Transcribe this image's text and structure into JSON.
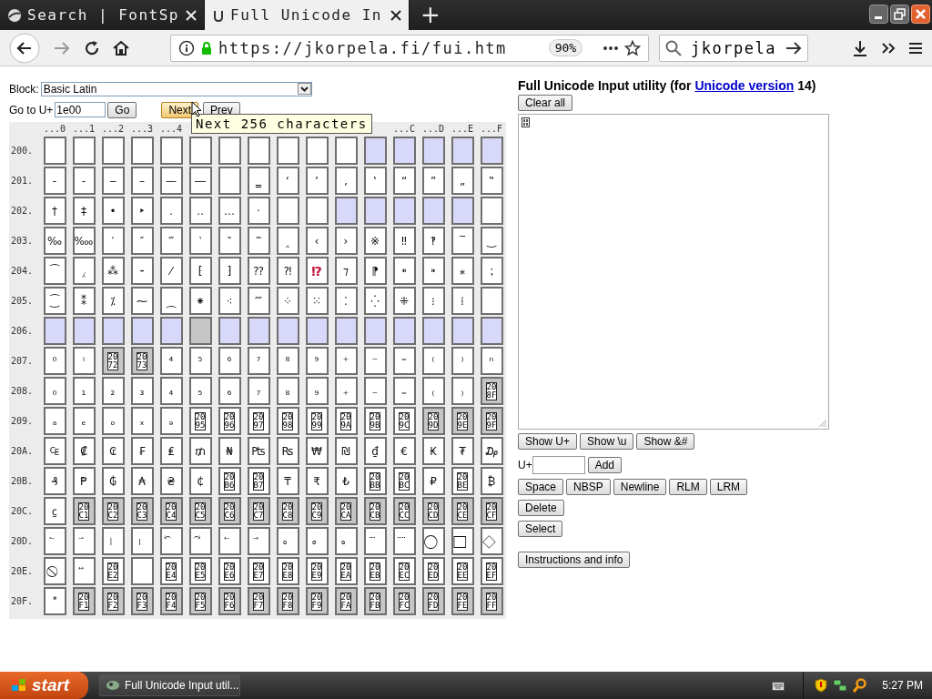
{
  "browser": {
    "tabs": [
      {
        "title": "Search | FontSp",
        "selected": false
      },
      {
        "title": "Full Unicode In",
        "selected": true
      }
    ],
    "new_tab": "+",
    "url": "https://jkorpela.fi/fui.htm",
    "zoom": "90%",
    "search": "jkorpela"
  },
  "left": {
    "block_label": "Block:",
    "block_value": "Basic Latin",
    "goto_label": "Go to U+",
    "goto_value": "1e00",
    "buttons": [
      "Go",
      "Next",
      "Prev"
    ]
  },
  "tooltip": "Next 256 characters",
  "grid": {
    "headers_left": [
      "...0",
      "...1",
      "...2",
      "...3",
      "...4"
    ],
    "headers_right": [
      "...C",
      "...D",
      "...E",
      "...F"
    ],
    "rows": [
      {
        "label": "200.",
        "cells": [
          {
            "kind": "blank"
          },
          {
            "kind": "blank"
          },
          {
            "kind": "blank"
          },
          {
            "kind": "blank"
          },
          {
            "kind": "blank"
          },
          {
            "kind": "blank"
          },
          {
            "kind": "blank"
          },
          {
            "kind": "blank"
          },
          {
            "kind": "blank"
          },
          {
            "kind": "blank"
          },
          {
            "kind": "blank"
          },
          {
            "kind": "format"
          },
          {
            "kind": "format"
          },
          {
            "kind": "format"
          },
          {
            "kind": "format"
          },
          {
            "kind": "format"
          }
        ]
      },
      {
        "label": "201.",
        "cells": [
          {
            "kind": "char",
            "text": "‐"
          },
          {
            "kind": "char",
            "text": "‑"
          },
          {
            "kind": "char",
            "text": "‒"
          },
          {
            "kind": "char",
            "text": "–"
          },
          {
            "kind": "char",
            "text": "—"
          },
          {
            "kind": "char",
            "text": "―"
          },
          {
            "kind": "blank"
          },
          {
            "kind": "char",
            "text": "‗"
          },
          {
            "kind": "char",
            "text": "‘"
          },
          {
            "kind": "char",
            "text": "’"
          },
          {
            "kind": "char",
            "text": "‚"
          },
          {
            "kind": "char",
            "text": "‛"
          },
          {
            "kind": "char",
            "text": "“"
          },
          {
            "kind": "char",
            "text": "”"
          },
          {
            "kind": "char",
            "text": "„"
          },
          {
            "kind": "char",
            "text": "‟"
          }
        ]
      },
      {
        "label": "202.",
        "cells": [
          {
            "kind": "char",
            "text": "†"
          },
          {
            "kind": "char",
            "text": "‡"
          },
          {
            "kind": "char",
            "text": "•"
          },
          {
            "kind": "char",
            "text": "‣"
          },
          {
            "kind": "char",
            "text": "․"
          },
          {
            "kind": "char",
            "text": "‥"
          },
          {
            "kind": "char",
            "text": "…"
          },
          {
            "kind": "char",
            "text": "‧"
          },
          {
            "kind": "blank"
          },
          {
            "kind": "blank"
          },
          {
            "kind": "format"
          },
          {
            "kind": "format"
          },
          {
            "kind": "format"
          },
          {
            "kind": "format"
          },
          {
            "kind": "format"
          },
          {
            "kind": "blank"
          }
        ]
      },
      {
        "label": "203.",
        "cells": [
          {
            "kind": "char",
            "text": "‰"
          },
          {
            "kind": "char",
            "text": "‱"
          },
          {
            "kind": "char",
            "text": "′"
          },
          {
            "kind": "char",
            "text": "″"
          },
          {
            "kind": "char",
            "text": "‴"
          },
          {
            "kind": "char",
            "text": "‵"
          },
          {
            "kind": "char",
            "text": "‶"
          },
          {
            "kind": "char",
            "text": "‷"
          },
          {
            "kind": "char",
            "text": "‸"
          },
          {
            "kind": "char",
            "text": "‹"
          },
          {
            "kind": "char",
            "text": "›"
          },
          {
            "kind": "char",
            "text": "※"
          },
          {
            "kind": "char",
            "text": "‼"
          },
          {
            "kind": "char",
            "text": "‽"
          },
          {
            "kind": "char",
            "text": "‾"
          },
          {
            "kind": "char",
            "text": "‿"
          }
        ]
      },
      {
        "label": "204.",
        "cells": [
          {
            "kind": "char",
            "text": "⁀"
          },
          {
            "kind": "char",
            "text": "⁁"
          },
          {
            "kind": "char",
            "text": "⁂"
          },
          {
            "kind": "char",
            "text": "⁃"
          },
          {
            "kind": "char",
            "text": "⁄"
          },
          {
            "kind": "char",
            "text": "⁅"
          },
          {
            "kind": "char",
            "text": "⁆"
          },
          {
            "kind": "char",
            "text": "⁇"
          },
          {
            "kind": "char",
            "text": "⁈"
          },
          {
            "kind": "char",
            "text": "⁉",
            "color": "#c0143c"
          },
          {
            "kind": "char",
            "text": "⁊"
          },
          {
            "kind": "char",
            "text": "⁋"
          },
          {
            "kind": "char",
            "text": "⁌"
          },
          {
            "kind": "char",
            "text": "⁍"
          },
          {
            "kind": "char",
            "text": "⁎"
          },
          {
            "kind": "char",
            "text": "⁏"
          }
        ]
      },
      {
        "label": "205.",
        "cells": [
          {
            "kind": "char",
            "text": "⁐"
          },
          {
            "kind": "char",
            "text": "⁑"
          },
          {
            "kind": "char",
            "text": "⁒"
          },
          {
            "kind": "char",
            "text": "⁓"
          },
          {
            "kind": "char",
            "text": "⁔"
          },
          {
            "kind": "char",
            "text": "⁕"
          },
          {
            "kind": "char",
            "text": "⁖"
          },
          {
            "kind": "char",
            "text": "⁗"
          },
          {
            "kind": "char",
            "text": "⁘"
          },
          {
            "kind": "char",
            "text": "⁙"
          },
          {
            "kind": "char",
            "text": "⁚"
          },
          {
            "kind": "char",
            "text": "⁛"
          },
          {
            "kind": "char",
            "text": "⁜"
          },
          {
            "kind": "char",
            "text": "⁝"
          },
          {
            "kind": "char",
            "text": "⁞"
          },
          {
            "kind": "blank"
          }
        ]
      },
      {
        "label": "206.",
        "cells": [
          {
            "kind": "format"
          },
          {
            "kind": "format"
          },
          {
            "kind": "format"
          },
          {
            "kind": "format"
          },
          {
            "kind": "format"
          },
          {
            "kind": "reserved"
          },
          {
            "kind": "format"
          },
          {
            "kind": "format"
          },
          {
            "kind": "format"
          },
          {
            "kind": "format"
          },
          {
            "kind": "format"
          },
          {
            "kind": "format"
          },
          {
            "kind": "format"
          },
          {
            "kind": "format"
          },
          {
            "kind": "format"
          },
          {
            "kind": "format"
          }
        ]
      },
      {
        "label": "207.",
        "cells": [
          {
            "kind": "char",
            "text": "⁰"
          },
          {
            "kind": "char",
            "text": "ⁱ"
          },
          {
            "kind": "tofu_reserved",
            "text": "2072"
          },
          {
            "kind": "tofu_reserved",
            "text": "2073"
          },
          {
            "kind": "char",
            "text": "⁴"
          },
          {
            "kind": "char",
            "text": "⁵"
          },
          {
            "kind": "char",
            "text": "⁶"
          },
          {
            "kind": "char",
            "text": "⁷"
          },
          {
            "kind": "char",
            "text": "⁸"
          },
          {
            "kind": "char",
            "text": "⁹"
          },
          {
            "kind": "char",
            "text": "⁺"
          },
          {
            "kind": "char",
            "text": "⁻"
          },
          {
            "kind": "char",
            "text": "⁼"
          },
          {
            "kind": "char",
            "text": "⁽"
          },
          {
            "kind": "char",
            "text": "⁾"
          },
          {
            "kind": "char",
            "text": "ⁿ"
          }
        ]
      },
      {
        "label": "208.",
        "cells": [
          {
            "kind": "char",
            "text": "₀"
          },
          {
            "kind": "char",
            "text": "₁"
          },
          {
            "kind": "char",
            "text": "₂"
          },
          {
            "kind": "char",
            "text": "₃"
          },
          {
            "kind": "char",
            "text": "₄"
          },
          {
            "kind": "char",
            "text": "₅"
          },
          {
            "kind": "char",
            "text": "₆"
          },
          {
            "kind": "char",
            "text": "₇"
          },
          {
            "kind": "char",
            "text": "₈"
          },
          {
            "kind": "char",
            "text": "₉"
          },
          {
            "kind": "char",
            "text": "₊"
          },
          {
            "kind": "char",
            "text": "₋"
          },
          {
            "kind": "char",
            "text": "₌"
          },
          {
            "kind": "char",
            "text": "₍"
          },
          {
            "kind": "char",
            "text": "₎"
          },
          {
            "kind": "tofu_reserved",
            "text": "208F"
          }
        ]
      },
      {
        "label": "209.",
        "cells": [
          {
            "kind": "char",
            "text": "ₐ"
          },
          {
            "kind": "char",
            "text": "ₑ"
          },
          {
            "kind": "char",
            "text": "ₒ"
          },
          {
            "kind": "char",
            "text": "ₓ"
          },
          {
            "kind": "char",
            "text": "ₔ"
          },
          {
            "kind": "tofu",
            "text": "2095"
          },
          {
            "kind": "tofu",
            "text": "2096"
          },
          {
            "kind": "tofu",
            "text": "2097"
          },
          {
            "kind": "tofu",
            "text": "2098"
          },
          {
            "kind": "tofu",
            "text": "2099"
          },
          {
            "kind": "tofu",
            "text": "209A"
          },
          {
            "kind": "tofu",
            "text": "209B"
          },
          {
            "kind": "tofu",
            "text": "209C"
          },
          {
            "kind": "tofu_reserved",
            "text": "209D"
          },
          {
            "kind": "tofu_reserved",
            "text": "209E"
          },
          {
            "kind": "tofu_reserved",
            "text": "209F"
          }
        ]
      },
      {
        "label": "20A.",
        "cells": [
          {
            "kind": "char",
            "text": "₠"
          },
          {
            "kind": "char",
            "text": "₡"
          },
          {
            "kind": "char",
            "text": "₢"
          },
          {
            "kind": "char",
            "text": "₣"
          },
          {
            "kind": "char",
            "text": "₤"
          },
          {
            "kind": "char",
            "text": "₥"
          },
          {
            "kind": "char",
            "text": "₦"
          },
          {
            "kind": "char",
            "text": "₧"
          },
          {
            "kind": "char",
            "text": "₨"
          },
          {
            "kind": "char",
            "text": "₩"
          },
          {
            "kind": "char",
            "text": "₪"
          },
          {
            "kind": "char",
            "text": "₫"
          },
          {
            "kind": "char",
            "text": "€"
          },
          {
            "kind": "char",
            "text": "₭"
          },
          {
            "kind": "char",
            "text": "₮"
          },
          {
            "kind": "char",
            "text": "₯"
          }
        ]
      },
      {
        "label": "20B.",
        "cells": [
          {
            "kind": "char",
            "text": "₰"
          },
          {
            "kind": "char",
            "text": "₱"
          },
          {
            "kind": "char",
            "text": "₲"
          },
          {
            "kind": "char",
            "text": "₳"
          },
          {
            "kind": "char",
            "text": "₴"
          },
          {
            "kind": "char",
            "text": "₵"
          },
          {
            "kind": "tofu",
            "text": "20B6"
          },
          {
            "kind": "tofu",
            "text": "20B7"
          },
          {
            "kind": "char",
            "text": "₸"
          },
          {
            "kind": "char",
            "text": "₹"
          },
          {
            "kind": "char",
            "text": "₺"
          },
          {
            "kind": "tofu",
            "text": "20BB"
          },
          {
            "kind": "tofu",
            "text": "20BC"
          },
          {
            "kind": "char",
            "text": "₽"
          },
          {
            "kind": "tofu",
            "text": "20BE"
          },
          {
            "kind": "char",
            "text": "₿"
          }
        ]
      },
      {
        "label": "20C.",
        "cells": [
          {
            "kind": "char",
            "text": "⃀"
          },
          {
            "kind": "tofu_reserved",
            "text": "20C1"
          },
          {
            "kind": "tofu_reserved",
            "text": "20C2"
          },
          {
            "kind": "tofu_reserved",
            "text": "20C3"
          },
          {
            "kind": "tofu_reserved",
            "text": "20C4"
          },
          {
            "kind": "tofu_reserved",
            "text": "20C5"
          },
          {
            "kind": "tofu_reserved",
            "text": "20C6"
          },
          {
            "kind": "tofu_reserved",
            "text": "20C7"
          },
          {
            "kind": "tofu_reserved",
            "text": "20C8"
          },
          {
            "kind": "tofu_reserved",
            "text": "20C9"
          },
          {
            "kind": "tofu_reserved",
            "text": "20CA"
          },
          {
            "kind": "tofu_reserved",
            "text": "20CB"
          },
          {
            "kind": "tofu_reserved",
            "text": "20CC"
          },
          {
            "kind": "tofu_reserved",
            "text": "20CD"
          },
          {
            "kind": "tofu_reserved",
            "text": "20CE"
          },
          {
            "kind": "tofu_reserved",
            "text": "20CF"
          }
        ]
      },
      {
        "label": "20D.",
        "cells": [
          {
            "kind": "char",
            "text": "⃐"
          },
          {
            "kind": "char",
            "text": "⃑"
          },
          {
            "kind": "char",
            "text": "⃒"
          },
          {
            "kind": "char",
            "text": "⃓"
          },
          {
            "kind": "char",
            "text": "⃔"
          },
          {
            "kind": "char",
            "text": "⃕"
          },
          {
            "kind": "char",
            "text": "⃖"
          },
          {
            "kind": "char",
            "text": "⃗"
          },
          {
            "kind": "char",
            "text": "⃘"
          },
          {
            "kind": "char",
            "text": "⃙"
          },
          {
            "kind": "char",
            "text": "⃚"
          },
          {
            "kind": "char",
            "text": "⃛"
          },
          {
            "kind": "char",
            "text": "⃜"
          },
          {
            "kind": "char",
            "text": "⃝"
          },
          {
            "kind": "char",
            "text": "⃞"
          },
          {
            "kind": "char",
            "text": "⃟"
          }
        ]
      },
      {
        "label": "20E.",
        "cells": [
          {
            "kind": "char",
            "text": "⃠"
          },
          {
            "kind": "char",
            "text": "⃡"
          },
          {
            "kind": "tofu",
            "text": "20E2"
          },
          {
            "kind": "blank"
          },
          {
            "kind": "tofu",
            "text": "20E4"
          },
          {
            "kind": "tofu",
            "text": "20E5"
          },
          {
            "kind": "tofu",
            "text": "20E6"
          },
          {
            "kind": "tofu",
            "text": "20E7"
          },
          {
            "kind": "tofu",
            "text": "20E8"
          },
          {
            "kind": "tofu",
            "text": "20E9"
          },
          {
            "kind": "tofu",
            "text": "20EA"
          },
          {
            "kind": "tofu",
            "text": "20EB"
          },
          {
            "kind": "tofu",
            "text": "20EC"
          },
          {
            "kind": "tofu",
            "text": "20ED"
          },
          {
            "kind": "tofu",
            "text": "20EE"
          },
          {
            "kind": "tofu",
            "text": "20EF"
          }
        ]
      },
      {
        "label": "20F.",
        "cells": [
          {
            "kind": "char",
            "text": "⃰"
          },
          {
            "kind": "tofu_reserved",
            "text": "20F1"
          },
          {
            "kind": "tofu_reserved",
            "text": "20F2"
          },
          {
            "kind": "tofu_reserved",
            "text": "20F3"
          },
          {
            "kind": "tofu_reserved",
            "text": "20F4"
          },
          {
            "kind": "tofu_reserved",
            "text": "20F5"
          },
          {
            "kind": "tofu_reserved",
            "text": "20F6"
          },
          {
            "kind": "tofu_reserved",
            "text": "20F7"
          },
          {
            "kind": "tofu_reserved",
            "text": "20F8"
          },
          {
            "kind": "tofu_reserved",
            "text": "20F9"
          },
          {
            "kind": "tofu_reserved",
            "text": "20FA"
          },
          {
            "kind": "tofu_reserved",
            "text": "20FB"
          },
          {
            "kind": "tofu_reserved",
            "text": "20FC"
          },
          {
            "kind": "tofu_reserved",
            "text": "20FD"
          },
          {
            "kind": "tofu_reserved",
            "text": "20FE"
          },
          {
            "kind": "tofu_reserved",
            "text": "20FF"
          }
        ]
      }
    ]
  },
  "right": {
    "title_before": "Full Unicode Input utility (for ",
    "title_link": "Unicode version",
    "title_after": " 14)",
    "clear_button": "Clear all",
    "show_buttons": [
      "Show U+",
      "Show \\u",
      "Show &#"
    ],
    "add_label": "U+",
    "add_button": "Add",
    "insert_buttons": [
      "Space",
      "NBSP",
      "Newline",
      "RLM",
      "LRM"
    ],
    "delete_button": "Delete",
    "select_button": "Select",
    "info_button": "Instructions and info"
  },
  "taskbar": {
    "start": "start",
    "task": "Full Unicode Input util...",
    "clock": "5:27 PM"
  }
}
